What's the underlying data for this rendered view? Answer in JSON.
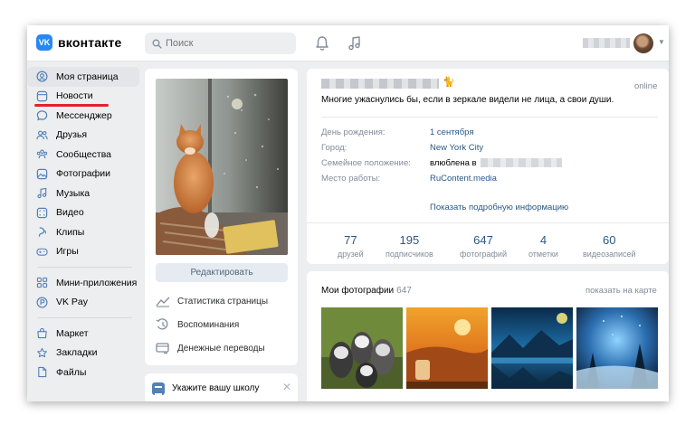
{
  "header": {
    "logo_mark": "VK",
    "logo_text": "вконтакте",
    "search_placeholder": "Поиск"
  },
  "sidebar": {
    "items": [
      {
        "label": "Моя страница",
        "icon": "user-circle-icon"
      },
      {
        "label": "Новости",
        "icon": "newsfeed-icon"
      },
      {
        "label": "Мессенджер",
        "icon": "message-icon"
      },
      {
        "label": "Друзья",
        "icon": "friends-icon"
      },
      {
        "label": "Сообщества",
        "icon": "communities-icon"
      },
      {
        "label": "Фотографии",
        "icon": "photo-icon"
      },
      {
        "label": "Музыка",
        "icon": "music-icon"
      },
      {
        "label": "Видео",
        "icon": "video-icon"
      },
      {
        "label": "Клипы",
        "icon": "clips-icon"
      },
      {
        "label": "Игры",
        "icon": "gamepad-icon"
      }
    ],
    "items2": [
      {
        "label": "Мини-приложения",
        "icon": "apps-icon"
      },
      {
        "label": "VK Pay",
        "icon": "vkpay-icon"
      }
    ],
    "items3": [
      {
        "label": "Маркет",
        "icon": "market-icon"
      },
      {
        "label": "Закладки",
        "icon": "bookmark-icon"
      },
      {
        "label": "Файлы",
        "icon": "file-icon"
      }
    ],
    "accent_underline": "#e0242b"
  },
  "middle": {
    "edit_button": "Редактировать",
    "links": [
      "Статистика страницы",
      "Воспоминания",
      "Денежные переводы"
    ],
    "school_prompt": "Укажите вашу школу",
    "school_close": "✕"
  },
  "profile": {
    "online": "online",
    "status": "Многие ужаснулись бы, если в зеркале видели не лица, а свои души.",
    "info": [
      {
        "label": "День рождения:",
        "value": "1 сентября"
      },
      {
        "label": "Город:",
        "value": "New York City"
      },
      {
        "label": "Семейное положение:",
        "value": "влюблена в"
      },
      {
        "label": "Место работы:",
        "value": "RuContent.media"
      }
    ],
    "more_info": "Показать подробную информацию",
    "stats": [
      {
        "num": "77",
        "label": "друзей"
      },
      {
        "num": "195",
        "label": "подписчиков"
      },
      {
        "num": "647",
        "label": "фотографий"
      },
      {
        "num": "4",
        "label": "отметки"
      },
      {
        "num": "60",
        "label": "видеозаписей"
      }
    ]
  },
  "photos": {
    "title": "Мои фотографии",
    "count": "647",
    "map_link": "показать на карте"
  },
  "colors": {
    "brand": "#2787f5",
    "link": "#2a5885",
    "muted": "#818c99",
    "background": "#edeef0"
  }
}
